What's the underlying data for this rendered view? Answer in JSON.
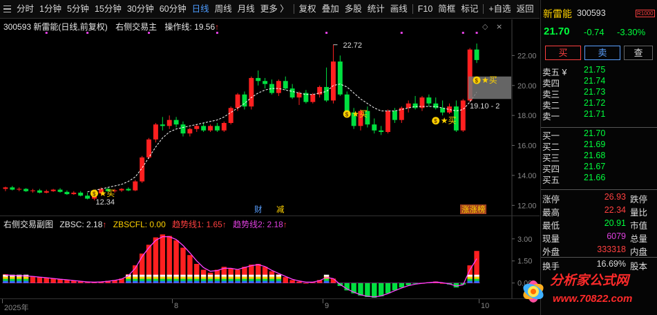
{
  "toolbar": {
    "items": [
      "分时",
      "1分钟",
      "5分钟",
      "15分钟",
      "30分钟",
      "60分钟",
      "日线",
      "周线",
      "月线",
      "更多 〉",
      "复权",
      "叠加",
      "多股",
      "统计",
      "画线",
      "F10",
      "简框",
      "标记",
      "+自选",
      "返回"
    ],
    "active": "日线"
  },
  "main_chart": {
    "header": {
      "stock": "300593 新雷能(日线,前复权)",
      "indicator": "右侧交易主",
      "op_label": "操作线: 19.56",
      "op_arrow": "↑"
    },
    "price_labels": {
      "high": "22.72",
      "low": "12.34",
      "box": "19.10 - 2"
    },
    "buy_signal_text": "★买",
    "event_tags": [
      "财",
      "减",
      "涨涨榜"
    ],
    "chart_data": {
      "type": "candlestick",
      "ylim": [
        11.6,
        23.4
      ],
      "y_ticks": [
        "22.00",
        "20.00",
        "18.00",
        "16.00",
        "14.00",
        "12.00"
      ],
      "candles": [
        [
          13.1,
          13.25,
          12.95,
          13.2
        ],
        [
          13.2,
          13.3,
          13.0,
          13.05
        ],
        [
          13.05,
          13.2,
          12.95,
          13.1
        ],
        [
          13.1,
          13.15,
          12.9,
          12.95
        ],
        [
          12.95,
          13.1,
          12.85,
          13.0
        ],
        [
          13.0,
          13.1,
          12.8,
          12.85
        ],
        [
          12.85,
          13.05,
          12.8,
          12.95
        ],
        [
          12.95,
          13.1,
          12.9,
          13.05
        ],
        [
          13.05,
          13.15,
          12.85,
          12.9
        ],
        [
          12.9,
          13.0,
          12.7,
          12.75
        ],
        [
          12.75,
          12.95,
          12.7,
          12.85
        ],
        [
          12.85,
          12.95,
          12.6,
          12.65
        ],
        [
          12.65,
          12.85,
          12.4,
          12.45
        ],
        [
          12.45,
          12.9,
          12.34,
          12.8
        ],
        [
          12.8,
          13.2,
          12.7,
          13.1
        ],
        [
          13.1,
          13.2,
          12.9,
          12.95
        ],
        [
          12.95,
          13.1,
          12.85,
          13.0
        ],
        [
          13.0,
          13.15,
          12.9,
          13.1
        ],
        [
          13.1,
          13.2,
          12.95,
          13.0
        ],
        [
          13.0,
          13.7,
          12.95,
          13.6
        ],
        [
          13.6,
          15.3,
          13.5,
          15.2
        ],
        [
          15.2,
          16.5,
          15.1,
          16.4
        ],
        [
          16.4,
          17.5,
          16.2,
          17.4
        ],
        [
          17.4,
          17.9,
          17.0,
          17.3
        ],
        [
          17.3,
          18.0,
          17.1,
          17.7
        ],
        [
          17.7,
          17.9,
          17.2,
          17.4
        ],
        [
          17.4,
          17.6,
          16.6,
          16.8
        ],
        [
          16.8,
          17.2,
          16.6,
          17.1
        ],
        [
          17.1,
          17.4,
          16.9,
          17.3
        ],
        [
          17.3,
          17.5,
          16.9,
          17.0
        ],
        [
          17.0,
          17.4,
          16.9,
          17.3
        ],
        [
          17.3,
          17.5,
          16.9,
          17.0
        ],
        [
          17.0,
          17.6,
          16.9,
          17.5
        ],
        [
          17.5,
          18.6,
          17.4,
          18.5
        ],
        [
          18.5,
          19.5,
          18.3,
          19.4
        ],
        [
          19.4,
          19.6,
          18.4,
          18.6
        ],
        [
          18.6,
          20.6,
          18.4,
          20.5
        ],
        [
          20.5,
          21.0,
          20.0,
          20.3
        ],
        [
          20.3,
          20.5,
          19.8,
          20.1
        ],
        [
          20.1,
          20.4,
          19.4,
          19.5
        ],
        [
          19.5,
          20.4,
          19.3,
          20.3
        ],
        [
          20.3,
          20.6,
          19.7,
          19.8
        ],
        [
          19.8,
          20.1,
          19.1,
          19.2
        ],
        [
          19.2,
          19.6,
          18.7,
          19.5
        ],
        [
          19.5,
          19.7,
          18.8,
          18.9
        ],
        [
          18.9,
          19.5,
          18.8,
          19.4
        ],
        [
          19.4,
          20.0,
          19.2,
          19.9
        ],
        [
          19.9,
          21.2,
          18.9,
          19.0
        ],
        [
          19.0,
          22.72,
          18.8,
          21.6
        ],
        [
          21.6,
          22.0,
          19.3,
          19.4
        ],
        [
          19.4,
          19.6,
          17.9,
          18.2
        ],
        [
          18.2,
          18.5,
          17.1,
          17.3
        ],
        [
          17.3,
          18.4,
          17.0,
          18.3
        ],
        [
          18.3,
          18.6,
          17.2,
          17.4
        ],
        [
          17.4,
          17.8,
          16.8,
          17.0
        ],
        [
          17.0,
          17.3,
          16.7,
          16.9
        ],
        [
          16.9,
          18.4,
          16.8,
          18.3
        ],
        [
          18.3,
          18.5,
          17.5,
          17.7
        ],
        [
          17.7,
          18.6,
          17.5,
          18.5
        ],
        [
          18.5,
          19.0,
          18.2,
          18.8
        ],
        [
          18.8,
          19.3,
          18.4,
          18.5
        ],
        [
          18.5,
          19.3,
          18.3,
          19.2
        ],
        [
          19.2,
          19.4,
          18.6,
          18.8
        ],
        [
          18.8,
          19.2,
          18.4,
          18.5
        ],
        [
          18.5,
          19.0,
          18.0,
          18.2
        ],
        [
          18.2,
          18.8,
          18.1,
          18.6
        ],
        [
          18.6,
          19.0,
          16.9,
          17.0
        ],
        [
          17.0,
          19.1,
          16.9,
          19.0
        ],
        [
          19.0,
          22.5,
          18.9,
          22.4
        ],
        [
          22.4,
          22.8,
          21.5,
          21.7
        ]
      ],
      "op_line": [
        null,
        null,
        null,
        null,
        null,
        null,
        null,
        null,
        null,
        null,
        null,
        null,
        12.9,
        13.0,
        13.1,
        13.2,
        13.3,
        13.4,
        13.6,
        13.9,
        14.5,
        15.2,
        15.9,
        16.5,
        16.9,
        17.1,
        17.2,
        17.3,
        17.4,
        17.5,
        17.6,
        17.7,
        17.9,
        18.2,
        18.5,
        18.8,
        19.2,
        19.5,
        19.7,
        19.8,
        19.8,
        19.7,
        19.6,
        19.5,
        19.4,
        19.4,
        19.5,
        19.6,
        20.0,
        20.1,
        19.9,
        19.5,
        19.1,
        18.8,
        18.5,
        18.3,
        18.3,
        18.3,
        18.4,
        18.5,
        18.6,
        18.6,
        18.6,
        18.6,
        18.5,
        18.4,
        18.3,
        18.4,
        18.9,
        19.56
      ]
    }
  },
  "sub_chart": {
    "header": {
      "name": "右侧交易副图",
      "zbsc": "ZBSC: 2.18",
      "zbscfl": "ZBSCFL: 0.00",
      "trend1": "趋势线1: 1.65",
      "trend2": "趋势线2: 2.18"
    },
    "chart_data": {
      "type": "bar",
      "ylim": [
        -1.0,
        3.6
      ],
      "y_ticks": [
        "3.00",
        "1.50",
        "0.00"
      ],
      "values": [
        0.6,
        0.55,
        0.5,
        0.5,
        0.45,
        0.4,
        0.35,
        0.3,
        0.25,
        0.2,
        0.15,
        0.1,
        0.05,
        0.05,
        0.1,
        0.15,
        0.2,
        0.3,
        0.6,
        1.2,
        2.0,
        2.6,
        3.1,
        3.3,
        3.2,
        2.9,
        2.4,
        1.9,
        1.3,
        0.9,
        0.7,
        0.9,
        1.1,
        1.0,
        0.9,
        1.1,
        1.25,
        1.3,
        1.1,
        0.8,
        0.6,
        0.4,
        0.2,
        0.1,
        0.0,
        0.05,
        0.2,
        0.5,
        0.3,
        -0.2,
        -0.5,
        -0.7,
        -0.85,
        -0.95,
        -1.0,
        -0.9,
        -0.7,
        -0.5,
        -0.3,
        -0.15,
        -0.05,
        0.0,
        0.05,
        0.1,
        0.0,
        -0.1,
        -0.3,
        -0.1,
        1.2,
        2.18
      ],
      "trend1": [
        0.55,
        0.52,
        0.5,
        0.48,
        0.45,
        0.4,
        0.36,
        0.31,
        0.26,
        0.22,
        0.17,
        0.12,
        0.08,
        0.06,
        0.08,
        0.12,
        0.18,
        0.27,
        0.5,
        1.0,
        1.8,
        2.4,
        2.9,
        3.15,
        3.15,
        2.95,
        2.55,
        2.05,
        1.5,
        1.05,
        0.8,
        0.85,
        1.0,
        1.0,
        0.92,
        1.05,
        1.18,
        1.25,
        1.12,
        0.86,
        0.65,
        0.45,
        0.26,
        0.14,
        0.06,
        0.06,
        0.16,
        0.38,
        0.3,
        -0.1,
        -0.4,
        -0.62,
        -0.8,
        -0.9,
        -0.95,
        -0.88,
        -0.72,
        -0.52,
        -0.34,
        -0.18,
        -0.08,
        -0.02,
        0.03,
        0.07,
        0.02,
        -0.06,
        -0.2,
        -0.12,
        0.9,
        1.65
      ]
    }
  },
  "x_axis": [
    "2025年",
    "8",
    "9",
    "10"
  ],
  "quote": {
    "name": "新雷能",
    "code": "300593",
    "badge": "R1000",
    "price": "21.70",
    "change": "-0.74",
    "pct": "-3.30%",
    "buy_label": "买",
    "sell_label": "卖",
    "query_label": "查",
    "asks": [
      {
        "label": "卖五 ¥",
        "price": "21.75"
      },
      {
        "label": "卖四",
        "price": "21.74"
      },
      {
        "label": "卖三",
        "price": "21.73"
      },
      {
        "label": "卖二",
        "price": "21.72"
      },
      {
        "label": "卖一",
        "price": "21.71"
      }
    ],
    "bids": [
      {
        "label": "买一",
        "price": "21.70"
      },
      {
        "label": "买二",
        "price": "21.69"
      },
      {
        "label": "买三",
        "price": "21.68"
      },
      {
        "label": "买四",
        "price": "21.67"
      },
      {
        "label": "买五",
        "price": "21.66"
      }
    ],
    "stats": [
      {
        "l1": "涨停",
        "v1": "26.93",
        "c": "#ff4040",
        "l2": "跌停"
      },
      {
        "l1": "最高",
        "v1": "22.34",
        "c": "#ff4040",
        "l2": "量比"
      },
      {
        "l1": "最低",
        "v1": "20.91",
        "c": "#00ff3c",
        "l2": "市值"
      },
      {
        "l1": "现量",
        "v1": "6079",
        "c": "#e040e0",
        "l2": "总量"
      },
      {
        "l1": "外盘",
        "v1": "333318",
        "c": "#ff4040",
        "l2": "内盘"
      },
      {
        "l1": "换手",
        "v1": "16.69%",
        "c": "#dddddd",
        "l2": "股本"
      }
    ]
  },
  "watermark": {
    "title": "分析家公式网",
    "url": "www.70822.com"
  },
  "colors": {
    "up": "#ff2020",
    "down": "#00e040",
    "up_hollow": "#ff2020",
    "hollow_cyan": "#7fe9ff",
    "op_line": "#ffffff",
    "trend": "#ff40ff"
  }
}
